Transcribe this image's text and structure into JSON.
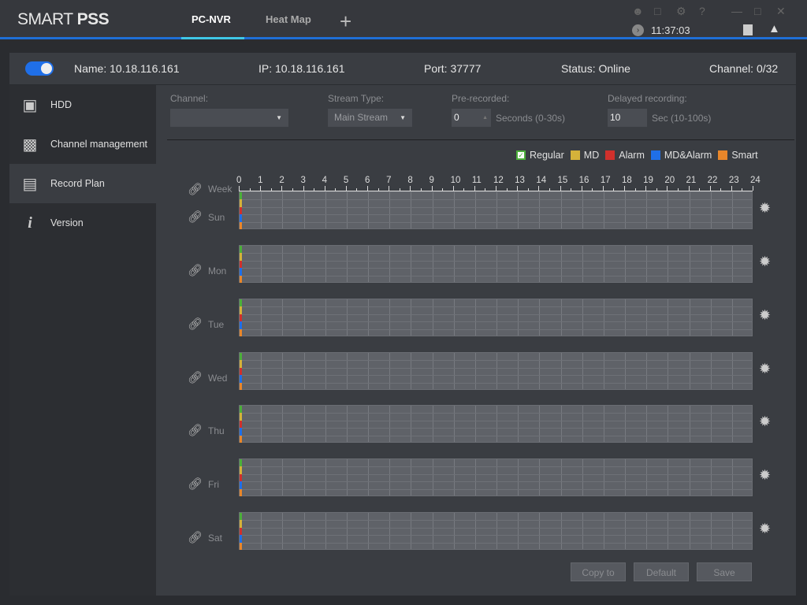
{
  "app": {
    "logo": "SMART PSS",
    "logo_light": "SMART ",
    "logo_bold": "PSS",
    "tabs": [
      {
        "label": "PC-NVR",
        "active": true
      },
      {
        "label": "Heat Map",
        "active": false
      }
    ],
    "add_tab": "+",
    "time": "11:37:03"
  },
  "device": {
    "enabled": true,
    "name_label": "Name:",
    "name": "10.18.116.161",
    "ip_label": "IP:",
    "ip": "10.18.116.161",
    "port_label": "Port:",
    "port": "37777",
    "status_label": "Status:",
    "status": "Online",
    "channel_label": "Channel:",
    "channel": "0/32"
  },
  "sidebar": {
    "items": [
      {
        "label": "HDD",
        "icon": "hdd-icon"
      },
      {
        "label": "Channel management",
        "icon": "camera-gear-icon"
      },
      {
        "label": "Record Plan",
        "icon": "clipboard-icon",
        "selected": true
      },
      {
        "label": "Version",
        "icon": "info-icon"
      }
    ]
  },
  "form": {
    "channel_label": "Channel:",
    "channel_value": "",
    "stream_label": "Stream Type:",
    "stream_value": "Main Stream",
    "pre_label": "Pre-recorded:",
    "pre_value": "0",
    "pre_hint": "Seconds (0-30s)",
    "delay_label": "Delayed recording:",
    "delay_value": "10",
    "delay_hint": "Sec (10-100s)"
  },
  "legend": [
    {
      "label": "Regular",
      "color": "#4caf3a",
      "checked": true
    },
    {
      "label": "MD",
      "color": "#d4b23a"
    },
    {
      "label": "Alarm",
      "color": "#d0302c"
    },
    {
      "label": "MD&Alarm",
      "color": "#1f6fe8"
    },
    {
      "label": "Smart",
      "color": "#e8862a"
    }
  ],
  "schedule": {
    "week_label": "Week",
    "hours": [
      "0",
      "1",
      "2",
      "3",
      "4",
      "5",
      "6",
      "7",
      "8",
      "9",
      "10",
      "11",
      "12",
      "13",
      "14",
      "15",
      "16",
      "17",
      "18",
      "19",
      "20",
      "21",
      "22",
      "23",
      "24"
    ],
    "days": [
      "Sun",
      "Mon",
      "Tue",
      "Wed",
      "Thu",
      "Fri",
      "Sat"
    ]
  },
  "buttons": {
    "copy": "Copy to",
    "default": "Default",
    "save": "Save"
  }
}
